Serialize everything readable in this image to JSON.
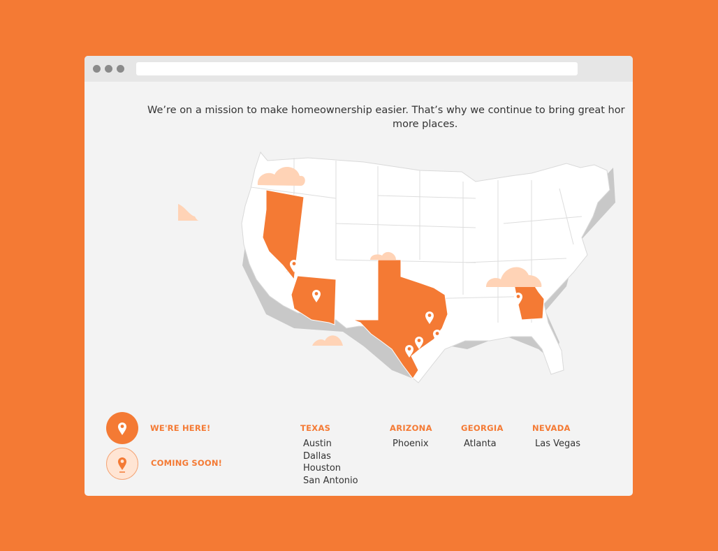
{
  "colors": {
    "background": "#f47a34",
    "accent": "#f47a34",
    "cloud": "#ffd3b6",
    "state_default": "#ffffff",
    "map_shadow": "#c8c8c8"
  },
  "browser": {
    "window_controls": [
      "dot-icon",
      "dot-icon",
      "dot-icon"
    ],
    "address_value": ""
  },
  "intro": {
    "line1": "We’re on a mission to make homeownership easier. That’s why we continue to bring great hor",
    "line2": "more places."
  },
  "map": {
    "highlighted_states": [
      "Texas",
      "Arizona",
      "Georgia",
      "Nevada"
    ],
    "markers": [
      "map-pin-icon"
    ]
  },
  "legend": {
    "here": {
      "label": "WE'RE HERE!",
      "icon": "map-pin-icon"
    },
    "soon": {
      "label": "COMING SOON!",
      "icon": "map-pin-icon"
    }
  },
  "locations": [
    {
      "state": "TEXAS",
      "cities": [
        "Austin",
        "Dallas",
        "Houston",
        "San Antonio"
      ]
    },
    {
      "state": "ARIZONA",
      "cities": [
        "Phoenix"
      ]
    },
    {
      "state": "GEORGIA",
      "cities": [
        "Atlanta"
      ]
    },
    {
      "state": "NEVADA",
      "cities": [
        "Las Vegas"
      ]
    }
  ]
}
